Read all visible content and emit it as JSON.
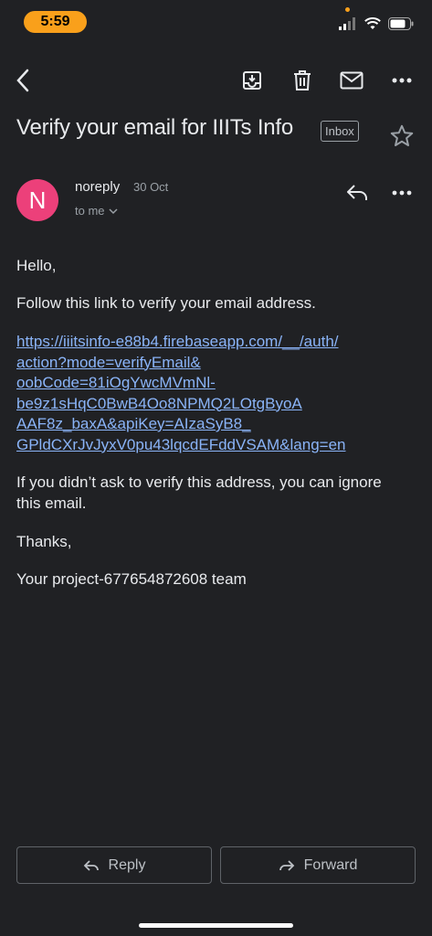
{
  "status_bar": {
    "time": "5:59"
  },
  "toolbar": {
    "back": "back-arrow-icon",
    "archive": "archive-icon",
    "delete": "trash-icon",
    "mark_unread": "mail-icon",
    "more": "more-horizontal-icon"
  },
  "email": {
    "subject": "Verify your email for IIITs Info",
    "label": "Inbox",
    "sender": {
      "initial": "N",
      "name": "noreply",
      "date": "30 Oct",
      "recipient": "to me",
      "avatar_color": "#ec407a"
    },
    "body": {
      "greeting": "Hello,",
      "instruction": "Follow this link to verify your email address.",
      "link_lines": [
        "https://iiitsinfo-e88b4.firebaseapp.com/__/auth/",
        "action?mode=verifyEmail&",
        "oobCode=81iOgYwcMVmNl-",
        "be9z1sHqC0BwB4Oo8NPMQ2LOtgByoA",
        "AAF8z_baxA&apiKey=AIzaSyB8_",
        "GPldCXrJvJyxV0pu43lqcdEFddVSAM&lang=en"
      ],
      "ignore_note": "If you didn’t ask to verify this address, you can ignore this email.",
      "thanks": "Thanks,",
      "signature": "Your project-677654872608 team"
    }
  },
  "actions": {
    "reply_label": "Reply",
    "forward_label": "Forward"
  },
  "colors": {
    "background": "#202124",
    "link": "#8ab4f8",
    "time_pill": "#f9a01b"
  }
}
